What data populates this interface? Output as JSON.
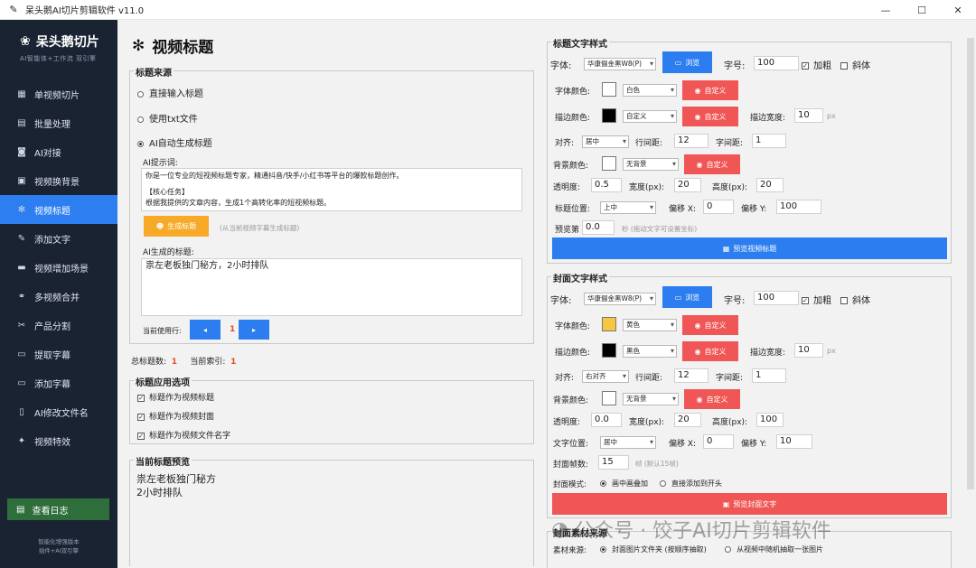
{
  "window": {
    "title": "呆头鹅AI切片剪辑软件 v11.0"
  },
  "sidebar": {
    "brand": "呆头鹅切片",
    "brand_sub": "AI智能体+工作流 双引擎",
    "items": [
      {
        "label": "单视频切片",
        "icon": "film-icon"
      },
      {
        "label": "批量处理",
        "icon": "stack-icon"
      },
      {
        "label": "AI对接",
        "icon": "robot-icon"
      },
      {
        "label": "视频换背景",
        "icon": "image-icon"
      },
      {
        "label": "视频标题",
        "icon": "title-icon"
      },
      {
        "label": "添加文字",
        "icon": "pen-icon"
      },
      {
        "label": "视频增加场景",
        "icon": "scene-icon"
      },
      {
        "label": "多视频合并",
        "icon": "merge-icon"
      },
      {
        "label": "产品分割",
        "icon": "scissors-icon"
      },
      {
        "label": "提取字幕",
        "icon": "subtitle-icon"
      },
      {
        "label": "添加字幕",
        "icon": "add-subtitle-icon"
      },
      {
        "label": "AI修改文件名",
        "icon": "file-icon"
      },
      {
        "label": "视频特效",
        "icon": "sparkle-icon"
      }
    ],
    "log_button": "查看日志",
    "footer_line1": "智能化增强版本",
    "footer_line2": "插件+AI双引擎"
  },
  "page": {
    "title": "视频标题"
  },
  "source": {
    "title": "标题来源",
    "opt1": "直接输入标题",
    "opt2": "使用txt文件",
    "opt3": "AI自动生成标题",
    "prompt_label": "AI提示词:",
    "prompt_line1": "你是一位专业的短视频标题专家，精通抖音/快手/小红书等平台的爆款标题创作。",
    "prompt_line2": "【核心任务】",
    "prompt_line3": "根据我提供的文章内容，生成1个高转化率的短视频标题。",
    "gen_button": "生成标题",
    "gen_hint": "(从当前视频字幕生成标题)",
    "gen_label": "AI生成的标题:",
    "gen_text": "祟左老板独门秘方，2小时排队",
    "current_row_label": "当前使用行:",
    "current_row_value": "1"
  },
  "stats": {
    "total_label": "总标题数:",
    "total": "1",
    "index_label": "当前索引:",
    "index": "1"
  },
  "apply": {
    "title": "标题应用选项",
    "opt1": "标题作为视频标题",
    "opt2": "标题作为视频封面",
    "opt3": "标题作为视频文件名字"
  },
  "preview": {
    "title": "当前标题预览",
    "line1": "祟左老板独门秘方",
    "line2": "2小时排队"
  },
  "title_style": {
    "title": "标题文字样式",
    "font_label": "字体:",
    "font_value": "华康俪金黑W8(P)",
    "browse": "浏览",
    "size_label": "字号:",
    "size_value": "100",
    "bold": "加粗",
    "italic": "斜体",
    "font_color_label": "字体颜色:",
    "font_color_value": "白色",
    "custom": "自定义",
    "stroke_color_label": "描边颜色:",
    "stroke_color_value": "自定义",
    "stroke_width_label": "描边宽度:",
    "stroke_width_value": "10",
    "px": "px",
    "align_label": "对齐:",
    "align_value": "居中",
    "line_spacing_label": "行间距:",
    "line_spacing_value": "12",
    "char_spacing_label": "字间距:",
    "char_spacing_value": "1",
    "bg_color_label": "背景颜色:",
    "bg_color_value": "无背景",
    "opacity_label": "透明度:",
    "opacity_value": "0.5",
    "width_label": "宽度(px):",
    "width_value": "20",
    "height_label": "高度(px):",
    "height_value": "20",
    "pos_label": "标题位置:",
    "pos_value": "上中",
    "offx_label": "偏移 X:",
    "offx_value": "0",
    "offy_label": "偏移 Y:",
    "offy_value": "100",
    "preview_frame_label": "预览第",
    "preview_frame_value": "0.0",
    "preview_frame_hint": "秒 (拖动文字可设置坐标)",
    "preview_button": "预览视频标题",
    "font_color_hex": "#ffffff",
    "stroke_color_hex": "#000000",
    "bg_hex": "#ffffff"
  },
  "cover_style": {
    "title": "封面文字样式",
    "font_label": "字体:",
    "font_value": "华康俪金黑W8(P)",
    "browse": "浏览",
    "size_label": "字号:",
    "size_value": "100",
    "bold": "加粗",
    "italic": "斜体",
    "font_color_label": "字体颜色:",
    "font_color_value": "黄色",
    "custom": "自定义",
    "stroke_color_label": "描边颜色:",
    "stroke_color_value": "黑色",
    "stroke_width_label": "描边宽度:",
    "stroke_width_value": "10",
    "px": "px",
    "align_label": "对齐:",
    "align_value": "右对齐",
    "line_spacing_label": "行间距:",
    "line_spacing_value": "12",
    "char_spacing_label": "字间距:",
    "char_spacing_value": "1",
    "bg_color_label": "背景颜色:",
    "bg_color_value": "无背景",
    "opacity_label": "透明度:",
    "opacity_value": "0.0",
    "width_label": "宽度(px):",
    "width_value": "20",
    "height_label": "高度(px):",
    "height_value": "100",
    "pos_label": "文字位置:",
    "pos_value": "居中",
    "offx_label": "偏移 X:",
    "offx_value": "0",
    "offy_label": "偏移 Y:",
    "offy_value": "10",
    "frames_label": "封面帧数:",
    "frames_value": "15",
    "frames_hint": "帧 (默认15帧)",
    "mode_label": "封面模式:",
    "mode_opt1": "画中画叠加",
    "mode_opt2": "直接添加到开头",
    "preview_button": "预览封面文字",
    "font_color_hex": "#f7c744",
    "stroke_color_hex": "#000000",
    "bg_hex": "#ffffff"
  },
  "material": {
    "title": "封面素材来源",
    "label": "素材来源:",
    "opt1": "封面图片文件夹 (按顺序抽取)",
    "opt2": "从视频中随机抽取一张图片"
  },
  "watermark": "公众号 · 饺子AI切片剪辑软件",
  "colors": {
    "accent": "#2b7df0",
    "red": "#f05656",
    "orange": "#f7a928",
    "sidebar": "#1a2332"
  }
}
